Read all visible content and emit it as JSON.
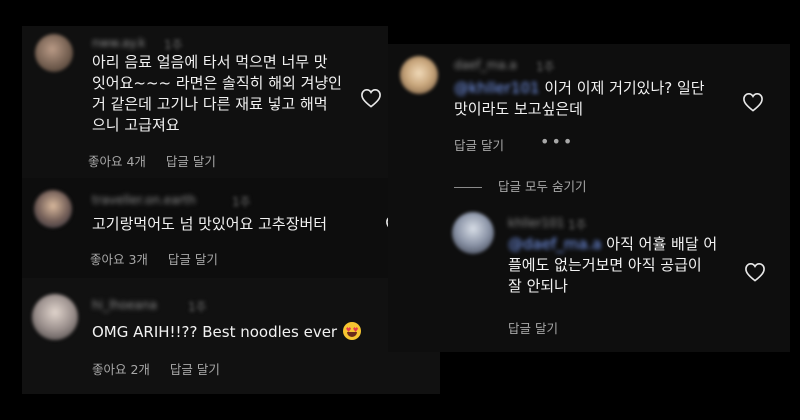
{
  "comments": [
    {
      "username": "nww.ay.k",
      "time": "1주",
      "lines": [
        "아리 음료 얼음에 타서 먹으면 너무 맛",
        "잇어요~~~ 라면은 솔직히 해외 겨냥인",
        "거 같은데 고기나 다른 재료 넣고 해먹",
        "으니 고급져요"
      ],
      "likes": "좋아요 4개",
      "reply": "답글 달기"
    },
    {
      "username": "traveller.on.earth",
      "time": "1주",
      "lines": [
        "고기랑먹어도 넘 맛있어요 고추장버터"
      ],
      "likes": "좋아요 3개",
      "reply": "답글 달기"
    },
    {
      "username": "hi_lhoeana",
      "time": "1주",
      "lines": [
        "OMG ARIH!!?? Best noodles ever"
      ],
      "likes": "좋아요 2개",
      "reply": "답글 달기"
    },
    {
      "username": "daef_ma.a",
      "time": "1주",
      "mention": "@khller101",
      "lines": [
        "이거 이제 거기있나? 일단",
        "맛이라도 보고싶은데"
      ],
      "reply": "답글 달기",
      "more": "•••"
    },
    {
      "username": "khller101",
      "time": "1주",
      "mention": "@daef_ma.a",
      "lines": [
        "아직 어휼 배달 어",
        "플에도 없는거보면 아직 공급이",
        "잘 안되나"
      ],
      "reply": "답글 달기"
    }
  ],
  "hide_replies": "답글 모두 숨기기",
  "colors": {
    "background": "#000000",
    "panel": "#101010",
    "text": "#f2f2f2",
    "meta": "#a8a8a8",
    "mention": "#7da1ff"
  },
  "icons": [
    "heart-icon",
    "heart-eyes-emoji",
    "more-icon"
  ]
}
